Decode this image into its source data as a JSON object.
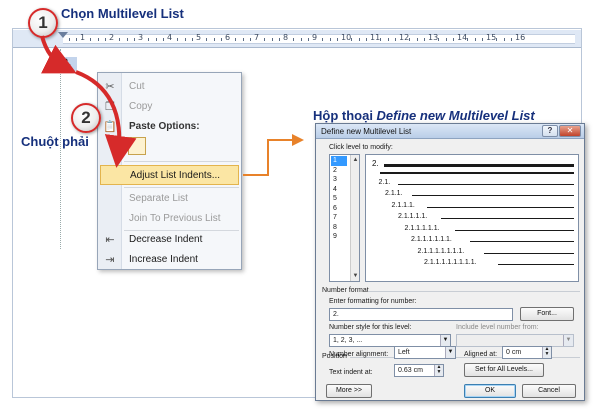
{
  "annotations": {
    "step1_number": "1",
    "step1_label": "Chọn Multilevel List",
    "step2_number": "2",
    "step2_label": "Chuột phải",
    "dialog_caption_prefix": "Hộp thoại ",
    "dialog_caption_italic": "Define new Multilevel List"
  },
  "document": {
    "list_number": "2.",
    "ruler_numbers": [
      "1",
      "2",
      "3",
      "4",
      "5",
      "6",
      "7",
      "8",
      "9",
      "10",
      "11",
      "12",
      "13",
      "14",
      "15",
      "16"
    ]
  },
  "context_menu": {
    "items": [
      {
        "label": "Cut",
        "icon": "scissors-icon",
        "disabled": true
      },
      {
        "label": "Copy",
        "icon": "copy-icon",
        "disabled": true
      },
      {
        "label": "Paste Options:",
        "icon": "paste-icon",
        "heading": true
      },
      {
        "label": "Adjust List Indents...",
        "hovered": true
      },
      {
        "label": "Separate List",
        "disabled": true
      },
      {
        "label": "Join To Previous List",
        "disabled": true
      },
      {
        "label": "Decrease Indent",
        "icon": "decrease-indent-icon"
      },
      {
        "label": "Increase Indent",
        "icon": "increase-indent-icon"
      }
    ]
  },
  "dialog": {
    "title": "Define new Multilevel List",
    "help": "?",
    "close": "✕",
    "click_level_label": "Click level to modify:",
    "levels": [
      "1",
      "2",
      "3",
      "4",
      "5",
      "6",
      "7",
      "8",
      "9"
    ],
    "selected_level": "1",
    "preview_labels": [
      "2.",
      "2.1.",
      "2.1.1.",
      "2.1.1.1.",
      "2.1.1.1.1.",
      "2.1.1.1.1.1.",
      "2.1.1.1.1.1.1.",
      "2.1.1.1.1.1.1.1.",
      "2.1.1.1.1.1.1.1.1."
    ],
    "number_format_heading": "Number format",
    "enter_formatting_label": "Enter formatting for number:",
    "formatting_value": "2.",
    "font_button": "Font...",
    "number_style_label": "Number style for this level:",
    "number_style_value": "1, 2, 3, ...",
    "include_level_label": "Include level number from:",
    "include_level_value": "",
    "position_heading": "Position",
    "number_alignment_label": "Number alignment:",
    "number_alignment_value": "Left",
    "aligned_at_label": "Aligned at:",
    "aligned_at_value": "0 cm",
    "text_indent_label": "Text indent at:",
    "text_indent_value": "0.63 cm",
    "set_all_levels_button": "Set for All Levels...",
    "more_button": "More >>",
    "ok_button": "OK",
    "cancel_button": "Cancel"
  },
  "colors": {
    "annotation_red": "#d62a2a",
    "annotation_text": "#16307c",
    "arrow_orange": "#e8822a",
    "menu_hover": "#fbe6a4"
  }
}
